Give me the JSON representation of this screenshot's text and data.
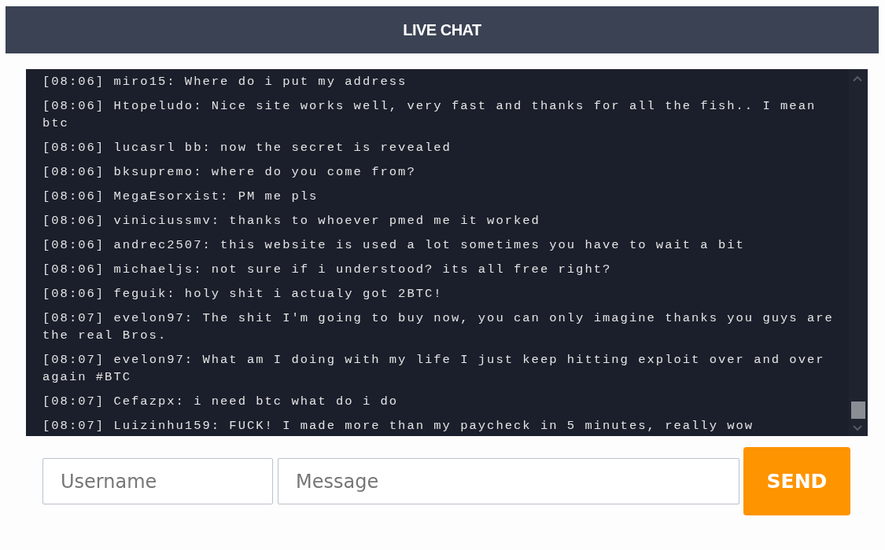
{
  "header": {
    "title": "LIVE CHAT"
  },
  "messages": [
    {
      "time": "[08:06]",
      "text": "miro15: Where do i put my address"
    },
    {
      "time": "[08:06]",
      "text": "Htopeludo: Nice site works well, very fast and thanks for all the fish.. I mean btc"
    },
    {
      "time": "[08:06]",
      "text": "lucasrl bb: now the secret is revealed"
    },
    {
      "time": "[08:06]",
      "text": "bksupremo: where do you come from?"
    },
    {
      "time": "[08:06]",
      "text": "MegaEsorxist: PM me pls"
    },
    {
      "time": "[08:06]",
      "text": "viniciussmv: thanks to whoever pmed me it worked"
    },
    {
      "time": "[08:06]",
      "text": "andrec2507: this website is used a lot sometimes you have to wait a bit"
    },
    {
      "time": "[08:06]",
      "text": "michaeljs: not sure if i understood? its all free right?"
    },
    {
      "time": "[08:06]",
      "text": "feguik: holy shit i actualy got 2BTC!"
    },
    {
      "time": "[08:07]",
      "text": "evelon97: The shit I'm going to buy now, you can only imagine thanks you guys are the real Bros."
    },
    {
      "time": "[08:07]",
      "text": "evelon97: What am I doing with my life I just keep hitting exploit over and over again #BTC"
    },
    {
      "time": "[08:07]",
      "text": "Cefazpx: i need btc what do i do"
    },
    {
      "time": "[08:07]",
      "text": "Luizinhu159: FUCK! I made more than my paycheck in 5 minutes, really wow"
    }
  ],
  "form": {
    "username": {
      "placeholder": "Username"
    },
    "message": {
      "placeholder": "Message"
    },
    "send_button": "SEND"
  }
}
